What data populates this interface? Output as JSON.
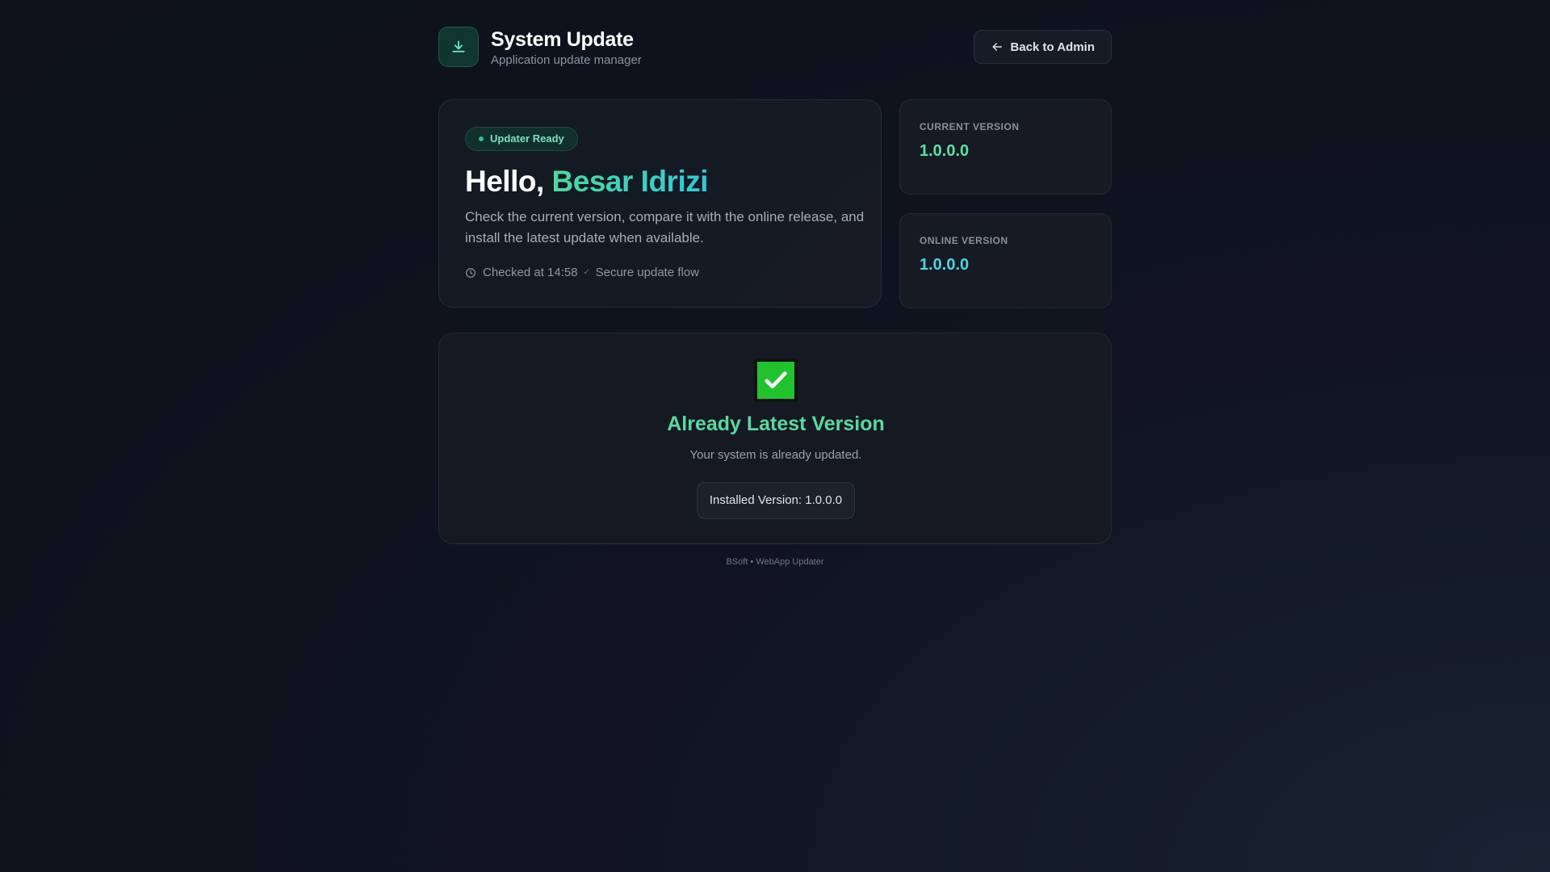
{
  "header": {
    "title": "System Update",
    "subtitle": "Application update manager",
    "logo_icon": "download-icon",
    "back_button": "Back to Admin",
    "back_icon": "arrow-left-icon"
  },
  "hello_card": {
    "badge": "Updater Ready",
    "greeting": "Hello,",
    "user_name": "Besar Idrizi",
    "description": "Check the current version, compare it with the online release, and install the latest update when available.",
    "checked": "Checked at 14:58",
    "secure": "Secure update flow",
    "clock_icon": "clock-icon",
    "check_icon": "checkmark-icon"
  },
  "versions": {
    "current_label": "CURRENT VERSION",
    "current_value": "1.0.0.0",
    "online_label": "ONLINE VERSION",
    "online_value": "1.0.0.0"
  },
  "status": {
    "icon": "check-box-icon",
    "title": "Already Latest Version",
    "subtitle": "Your system is already updated.",
    "installed": "Installed Version: 1.0.0.0"
  },
  "footer": "BSoft • WebApp Updater",
  "colors": {
    "accent_green": "#5ce0a6",
    "accent_cyan": "#4fd3e0",
    "check_green": "#22c22f",
    "background": "#0f1420"
  }
}
